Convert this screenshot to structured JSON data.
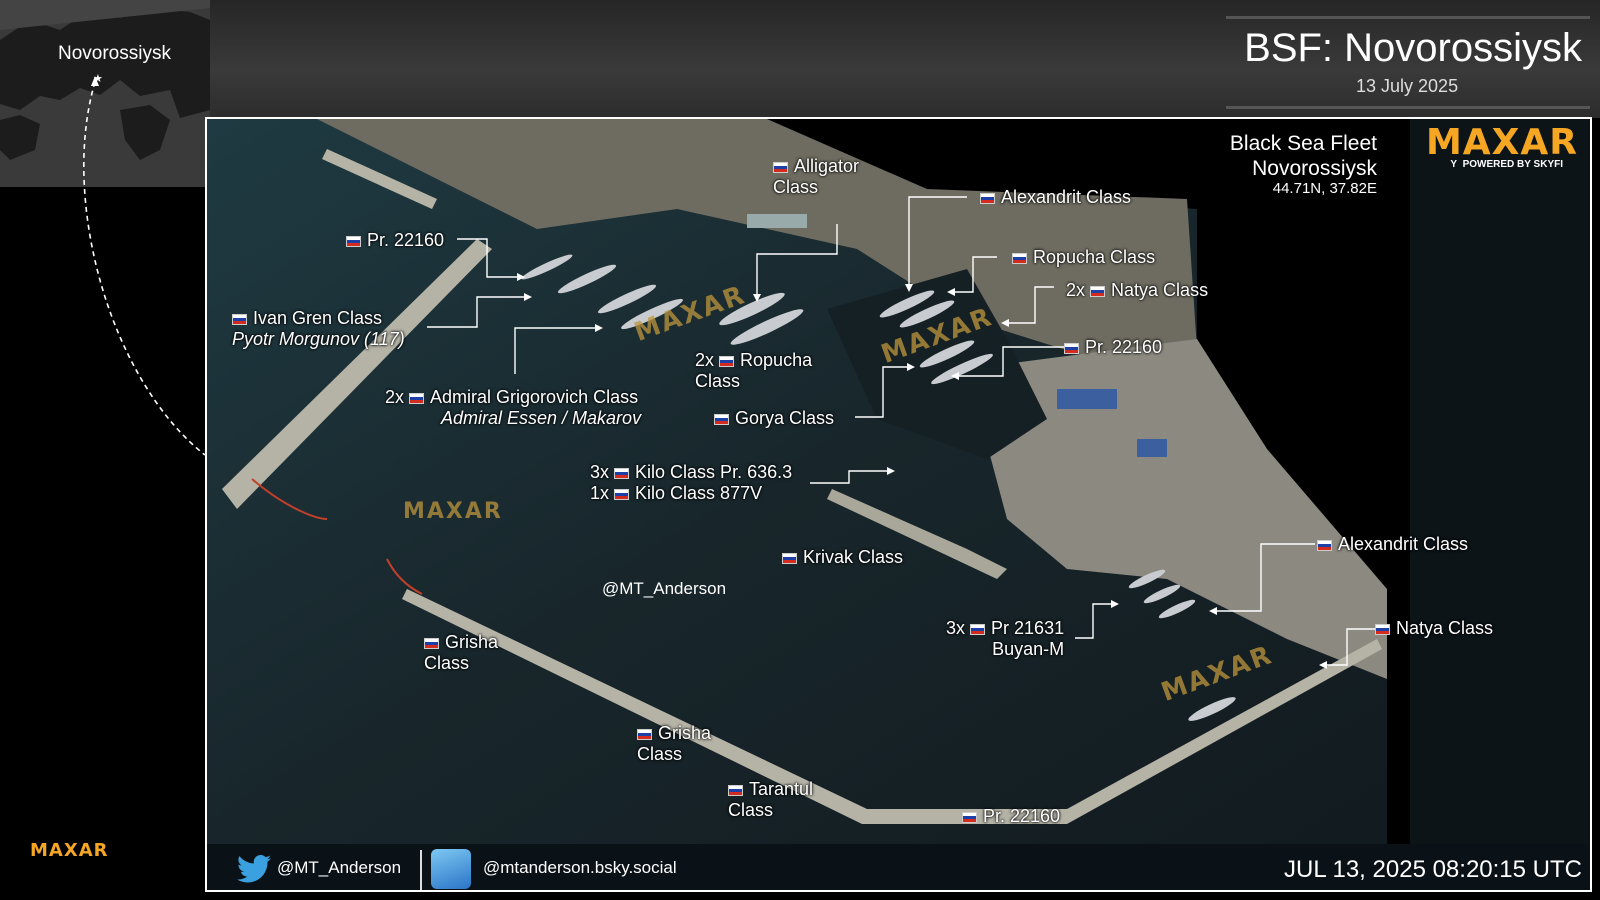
{
  "inset": {
    "location_label": "Novorossiysk"
  },
  "header": {
    "title": "BSF: Novorossiysk",
    "date": "13 July 2025"
  },
  "info": {
    "line1": "Black Sea Fleet",
    "line2": "Novorossiysk",
    "coordinates": "44.71N, 37.82E"
  },
  "branding": {
    "logo_text": "MAXAR",
    "powered_by": "POWERED BY SKYFI",
    "footer_logo": "MAXAR",
    "watermark": "MAXAR",
    "accent_color": "#f5a623"
  },
  "labels": {
    "alligator": "Alligator",
    "alligator_2": "Class",
    "alexandrit_top": "Alexandrit Class",
    "pr22160_top": "Pr. 22160",
    "ropucha_right": "Ropucha Class",
    "natya_2x": "2x",
    "natya_2x_name": "Natya Class",
    "ivan_gren": "Ivan Gren Class",
    "ivan_gren_sub": "Pyotr Morgunov (117)",
    "pr22160_mid": "Pr. 22160",
    "ropucha_2x": "2x",
    "ropucha_2x_name": "Ropucha",
    "ropucha_2x_sub": "Class",
    "grigorovich_2x": "2x",
    "grigorovich_name": "Admiral Grigorovich Class",
    "grigorovich_sub": "Admiral Essen / Makarov",
    "gorya": "Gorya Class",
    "kilo_3x": "3x",
    "kilo_3x_name": "Kilo Class Pr. 636.3",
    "kilo_1x": "1x",
    "kilo_1x_name": "Kilo Class 877V",
    "krivak": "Krivak Class",
    "alexandrit_right": "Alexandrit Class",
    "buyan_3x": "3x",
    "buyan_name": "Pr 21631",
    "buyan_sub": "Buyan-M",
    "natya_right": "Natya Class",
    "grisha_1": "Grisha",
    "grisha_1_sub": "Class",
    "grisha_2": "Grisha",
    "grisha_2_sub": "Class",
    "tarantul": "Tarantul",
    "tarantul_sub": "Class",
    "pr22160_bottom": "Pr. 22160"
  },
  "image_handle": "@MT_Anderson",
  "footer": {
    "twitter_handle": "@MT_Anderson",
    "bsky_handle": "@mtanderson.bsky.social",
    "timestamp": "JUL 13, 2025 08:20:15 UTC"
  }
}
